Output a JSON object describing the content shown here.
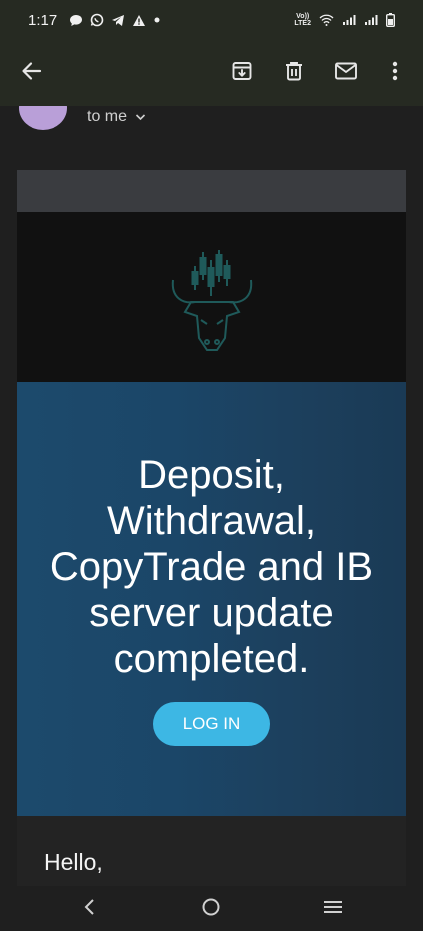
{
  "status_bar": {
    "time": "1:17",
    "left_icons": [
      "chat-bubble-icon",
      "whatsapp-icon",
      "telegram-icon",
      "warning-icon",
      "dot-icon"
    ],
    "right_icons": [
      "volte-icon",
      "wifi-icon",
      "signal-icon",
      "signal-icon",
      "battery-icon"
    ],
    "volte_line1": "Vo))",
    "volte_line2": "LTE2"
  },
  "app_bar": {
    "icons": [
      "back-arrow-icon",
      "archive-icon",
      "delete-icon",
      "mark-unread-icon",
      "more-vert-icon"
    ]
  },
  "sender": {
    "recipient_label": "to me"
  },
  "email": {
    "headline": "Deposit, Withdrawal, CopyTrade and IB server update completed.",
    "login_button": "LOG IN",
    "greeting": "Hello,"
  },
  "colors": {
    "accent_button": "#3db7e4",
    "hero_bg": "#1c4a6c",
    "logo": "#1f5a5a"
  },
  "nav_bar": {
    "icons": [
      "nav-back-icon",
      "nav-home-icon",
      "nav-recents-icon"
    ]
  }
}
